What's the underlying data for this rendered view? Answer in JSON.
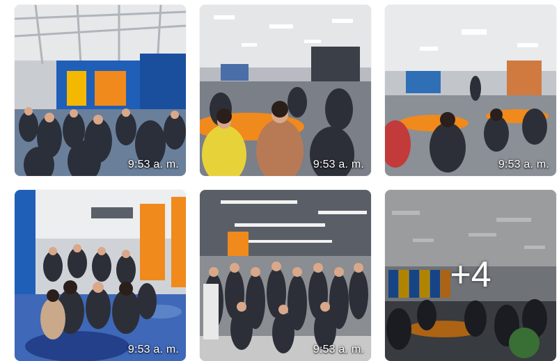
{
  "gallery": {
    "photos": [
      {
        "timestamp": "9:53 a. m.",
        "content": "group-photo"
      },
      {
        "timestamp": "9:53 a. m.",
        "content": "group-photo"
      },
      {
        "timestamp": "9:53 a. m.",
        "content": "group-photo"
      },
      {
        "timestamp": "9:53 a. m.",
        "content": "group-photo"
      },
      {
        "timestamp": "9:53 a. m.",
        "content": "group-photo"
      },
      {
        "timestamp": "",
        "content": "group-photo"
      }
    ],
    "more_count_label": "+4"
  },
  "colors": {
    "timestamp_text": "#ffffff",
    "accent_blue": "#1f5fb8",
    "accent_orange": "#f08a1c",
    "accent_yellow": "#f5b800"
  }
}
